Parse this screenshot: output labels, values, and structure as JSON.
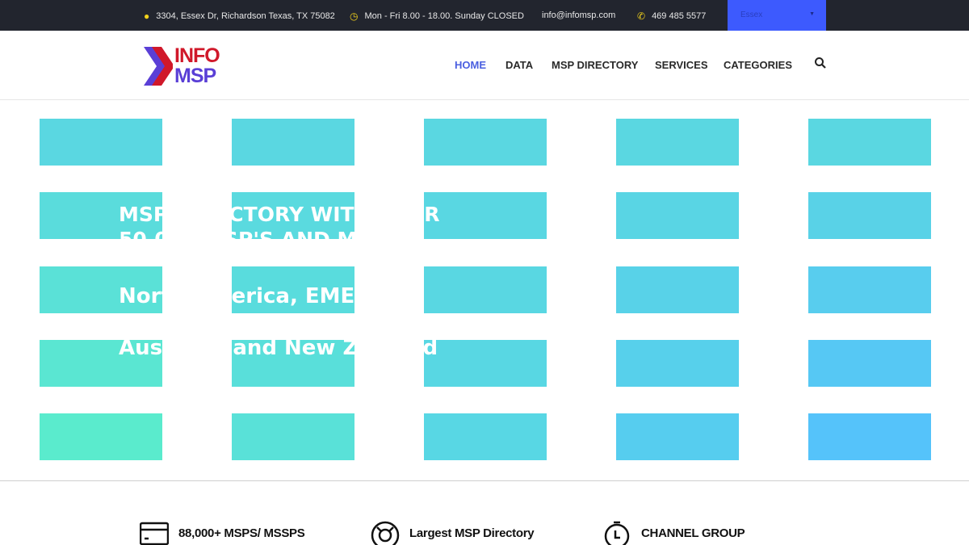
{
  "topbar": {
    "address": "3304, Essex Dr, Richardson Texas, TX 75082",
    "hours": "Mon - Fri 8.00 - 18.00. Sunday CLOSED",
    "email": "info@infomsp.com",
    "phone": "469 485 5577",
    "location_select": "Essex"
  },
  "logo": {
    "line1": "INFO",
    "line2": "MSP"
  },
  "nav": [
    "HOME",
    "DATA",
    "MSP DIRECTORY",
    "SERVICES",
    "CATEGORIES"
  ],
  "hero": {
    "line1": "MSP DIRECTORY WITH OVER",
    "line2": "50,000 MSP'S AND MSSP'S",
    "line3": "North America, EMEA,",
    "line4": "Australia and New Zealand"
  },
  "features": [
    {
      "label": "88,000+ MSPS/ MSSPS",
      "icon": "card-icon"
    },
    {
      "label": "Largest MSP Directory",
      "icon": "lifebuoy-icon"
    },
    {
      "label": "CHANNEL GROUP",
      "icon": "stopwatch-icon"
    }
  ],
  "colors": {
    "accent": "#3d5afe",
    "topbar": "#22252e",
    "logo_red": "#d0182a",
    "logo_purple": "#5a3fd6"
  }
}
